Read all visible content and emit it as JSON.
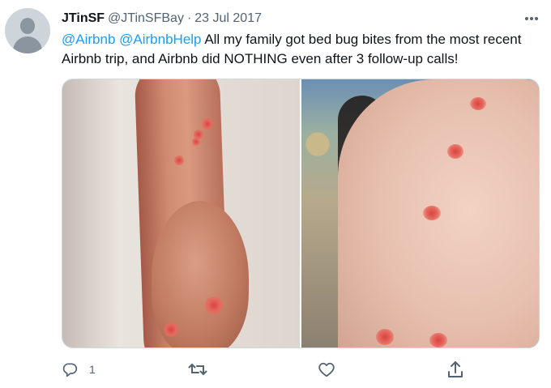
{
  "author": {
    "name": "JTinSF",
    "handle": "@JTinSFBay",
    "separator": "·",
    "date": "23 Jul 2017"
  },
  "tweet": {
    "mention_1": "@Airbnb",
    "mention_2": "@AirbnbHelp",
    "body": "All my family got bed bug bites from the most recent Airbnb trip, and Airbnb did NOTHING even after 3 follow-up calls!"
  },
  "actions": {
    "reply_count": "1"
  },
  "icons": {
    "more": "more-horizontal-icon",
    "reply": "reply-icon",
    "retweet": "retweet-icon",
    "like": "like-icon",
    "share": "share-icon"
  },
  "colors": {
    "accent": "#1d9bf0",
    "muted": "#536471",
    "text": "#0f1419"
  }
}
